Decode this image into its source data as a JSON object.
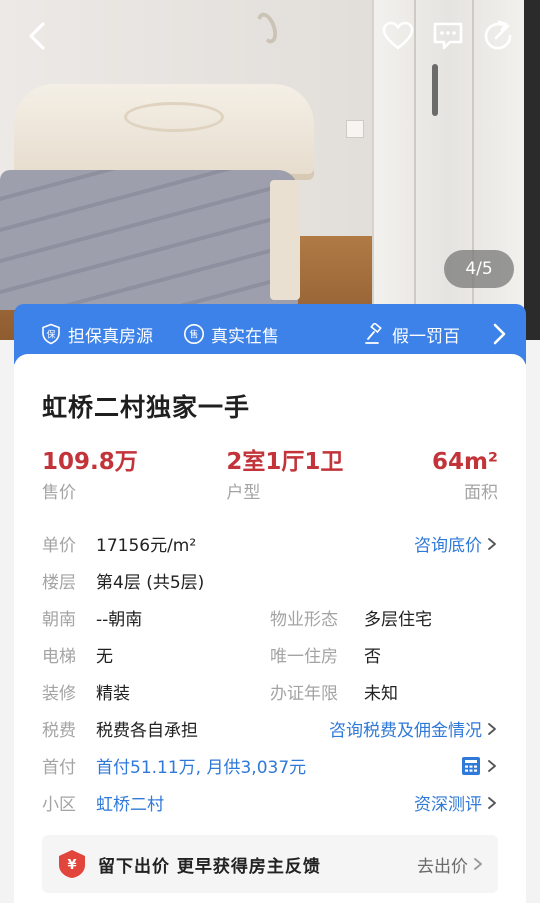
{
  "photo": {
    "counter": "4/5"
  },
  "guarantee": {
    "items": [
      {
        "icon": "shield-icon",
        "label": "担保真房源"
      },
      {
        "icon": "sale-badge-icon",
        "label": "真实在售"
      },
      {
        "icon": "gavel-icon",
        "label": "假一罚百"
      }
    ]
  },
  "listing": {
    "title": "虹桥二村独家一手",
    "stats": [
      {
        "value": "109.8万",
        "label": "售价"
      },
      {
        "value": "2室1厅1卫",
        "label": "户型"
      },
      {
        "value": "64m²",
        "label": "面积"
      }
    ],
    "unit_price": {
      "key": "单价",
      "value": "17156元/m²",
      "link": "咨询底价"
    },
    "floor": {
      "key": "楼层",
      "value": "第4层 (共5层)"
    },
    "orientation": {
      "key": "朝南",
      "value": "--朝南",
      "key2": "物业形态",
      "value2": "多层住宅"
    },
    "elevator": {
      "key": "电梯",
      "value": "无",
      "key2": "唯一住房",
      "value2": "否"
    },
    "decoration": {
      "key": "装修",
      "value": "精装",
      "key2": "办证年限",
      "value2": "未知"
    },
    "tax": {
      "key": "税费",
      "value": "税费各自承担",
      "link": "咨询税费及佣金情况"
    },
    "down_payment": {
      "key": "首付",
      "value": "首付51.11万, 月供3,037元"
    },
    "community": {
      "key": "小区",
      "value": "虹桥二村",
      "link": "资深测评"
    }
  },
  "offer": {
    "text": "留下出价 更早获得房主反馈",
    "action": "去出价"
  },
  "colors": {
    "accent_blue": "#3d82e8",
    "price_red": "#c2343a",
    "link_blue": "#2f79d8"
  }
}
